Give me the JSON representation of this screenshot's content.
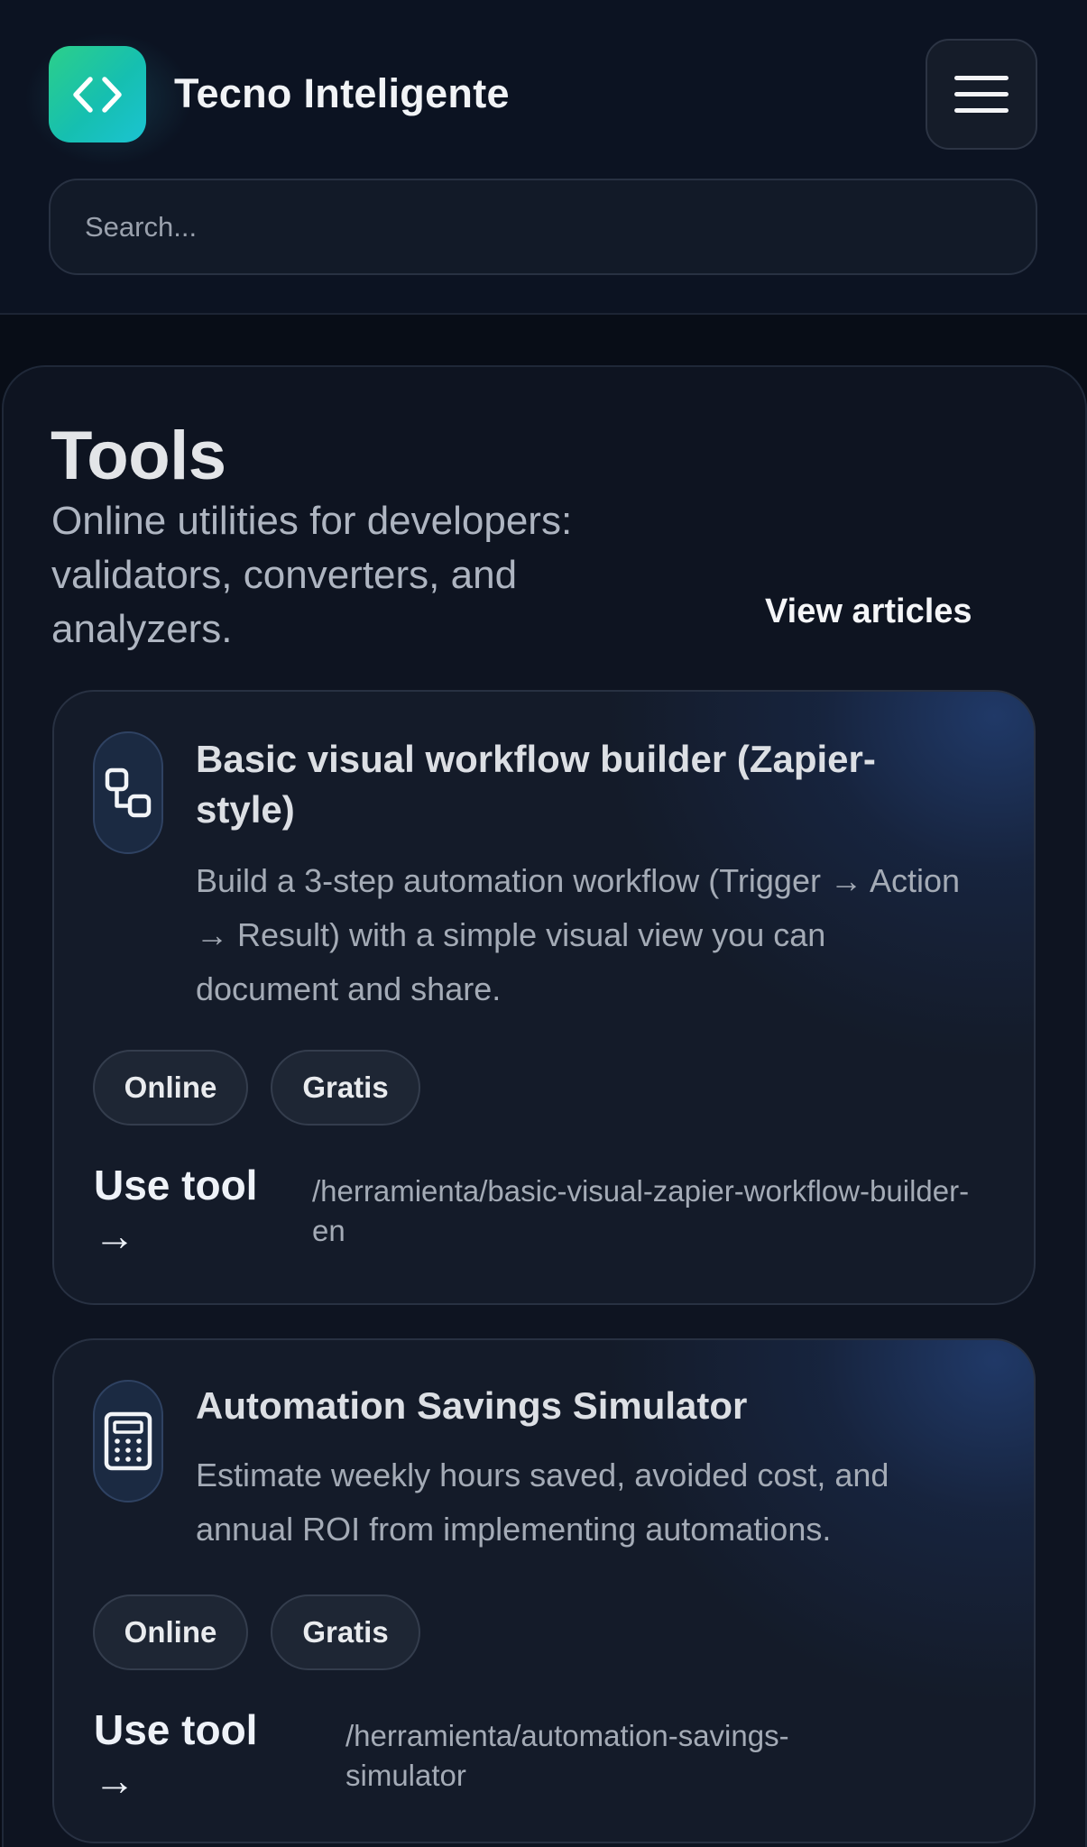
{
  "header": {
    "brand": "Tecno Inteligente",
    "logo_icon": "code-brackets-icon",
    "menu_icon": "hamburger-menu-icon",
    "search_placeholder": "Search..."
  },
  "main": {
    "title": "Tools",
    "subtitle": "Online utilities for developers: validators, converters, and analyzers.",
    "view_articles": "View articles"
  },
  "tools": [
    {
      "icon": "workflow-nodes-icon",
      "title": "Basic visual workflow builder (Zapier-style)",
      "description": "Build a 3-step automation workflow (Trigger → Action → Result) with a simple visual view you can document and share.",
      "tags": [
        "Online",
        "Gratis"
      ],
      "cta": "Use tool →",
      "path": "/herramienta/basic-visual-zapier-workflow-builder-en"
    },
    {
      "icon": "calculator-icon",
      "title": "Automation Savings Simulator",
      "description": "Estimate weekly hours saved, avoided cost, and annual ROI from implementing automations.",
      "tags": [
        "Online",
        "Gratis"
      ],
      "cta": "Use tool →",
      "path": "/herramienta/automation-savings-simulator"
    }
  ],
  "colors": {
    "background": "#080d17",
    "card": "#141b29",
    "logo_gradient_start": "#2ccf8a",
    "logo_gradient_end": "#1bc3d2",
    "card_glow": "#223e72"
  }
}
